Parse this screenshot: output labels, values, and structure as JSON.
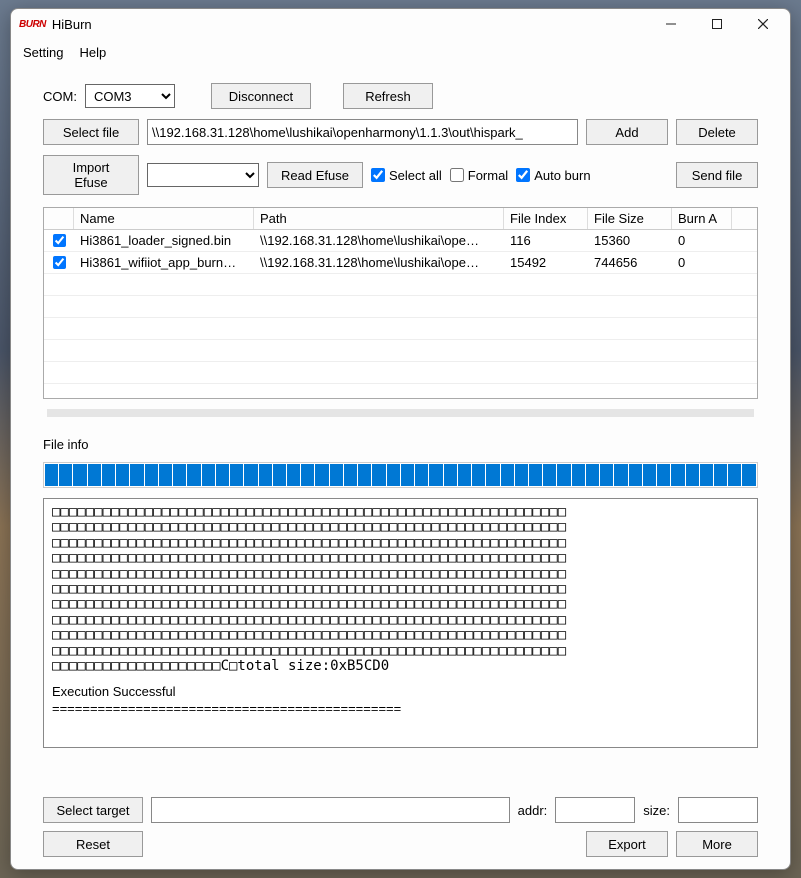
{
  "titlebar": {
    "app_icon_text": "BURN",
    "title": "HiBurn"
  },
  "menu": {
    "setting": "Setting",
    "help": "Help"
  },
  "com": {
    "label": "COM:",
    "value": "COM3"
  },
  "buttons": {
    "disconnect": "Disconnect",
    "refresh": "Refresh",
    "select_file": "Select file",
    "add": "Add",
    "delete": "Delete",
    "import_efuse": "Import Efuse",
    "read_efuse": "Read Efuse",
    "send_file": "Send file",
    "select_target": "Select target",
    "reset": "Reset",
    "export": "Export",
    "more": "More"
  },
  "path_input": "\\\\192.168.31.128\\home\\lushikai\\openharmony\\1.1.3\\out\\hispark_",
  "efuse_dropdown": "",
  "checks": {
    "select_all_label": "Select all",
    "select_all": true,
    "formal_label": "Formal",
    "formal": false,
    "auto_burn_label": "Auto burn",
    "auto_burn": true
  },
  "table": {
    "headers": {
      "name": "Name",
      "path": "Path",
      "file_index": "File Index",
      "file_size": "File Size",
      "burn_addr": "Burn A"
    },
    "rows": [
      {
        "checked": true,
        "name": "Hi3861_loader_signed.bin",
        "path": "\\\\192.168.31.128\\home\\lushikai\\ope…",
        "file_index": "116",
        "file_size": "15360",
        "burn": "0"
      },
      {
        "checked": true,
        "name": "Hi3861_wifiiot_app_burn…",
        "path": "\\\\192.168.31.128\\home\\lushikai\\ope…",
        "file_index": "15492",
        "file_size": "744656",
        "burn": "0"
      }
    ]
  },
  "file_info_label": "File info",
  "log": {
    "boxes_row": "□□□□□□□□□□□□□□□□□□□□□□□□□□□□□□□□□□□□□□□□□□□□□□□□□□□□□□□□□□□□□",
    "last_boxes": "□□□□□□□□□□□□□□□□□□□□C□total size:0xB5CD0",
    "status": "Execution Successful",
    "separator": "=============================================="
  },
  "bottom": {
    "addr_label": "addr:",
    "addr_value": "",
    "size_label": "size:",
    "size_value": "",
    "target_value": ""
  }
}
